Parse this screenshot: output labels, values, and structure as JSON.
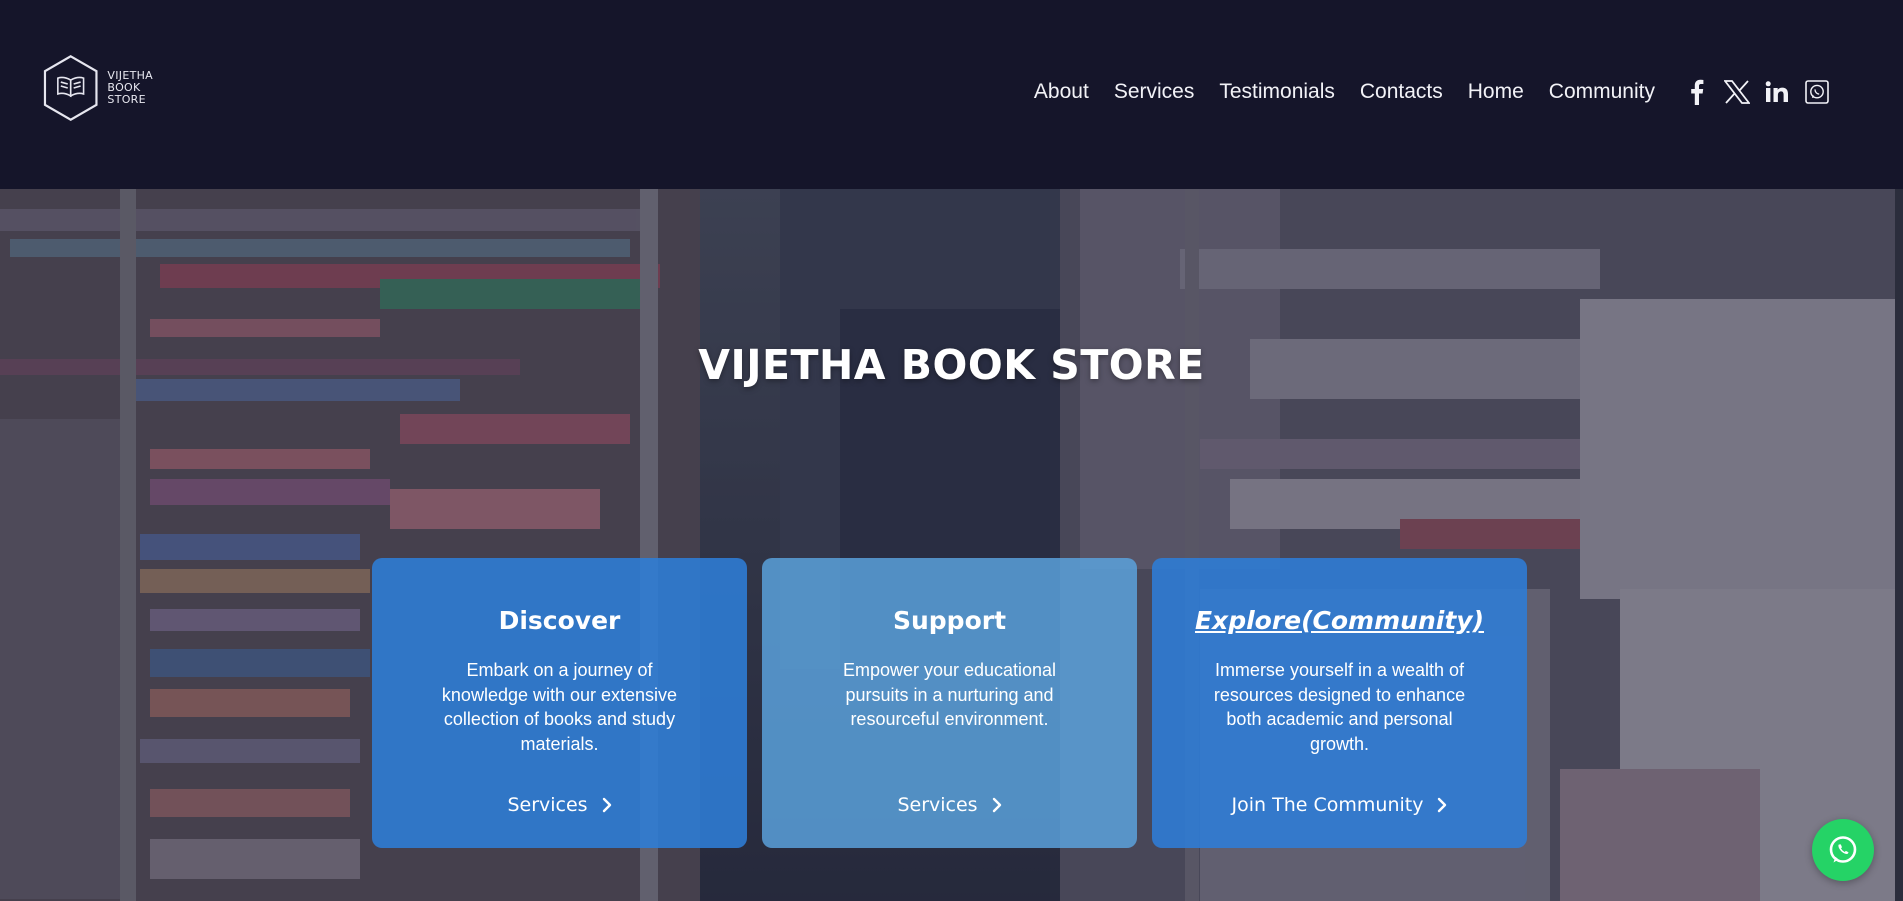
{
  "brand": {
    "logo_line1": "VIJETHA",
    "logo_line2": "BOOK STORE"
  },
  "nav": {
    "links": [
      "About",
      "Services",
      "Testimonials",
      "Contacts",
      "Home",
      "Community"
    ],
    "social_icons": [
      "facebook-icon",
      "x-twitter-icon",
      "linkedin-icon",
      "whatsapp-icon"
    ]
  },
  "hero": {
    "title": "VIJETHA BOOK STORE"
  },
  "cards": [
    {
      "title": "Discover",
      "text": "Embark on a journey of knowledge with our extensive collection of books and study materials.",
      "action": "Services"
    },
    {
      "title": "Support",
      "text": "Empower your educational pursuits in a nurturing and resourceful environment.",
      "action": "Services"
    },
    {
      "title": "Explore(Community)",
      "text": "Immerse yourself in a wealth of resources designed to enhance both academic and personal growth.",
      "action": "Join The Community"
    }
  ],
  "colors": {
    "header_bg": "#15152a",
    "card_blue": "#2d7dd7",
    "card_light_blue": "#5ca5e1",
    "whatsapp_green": "#25d366"
  }
}
